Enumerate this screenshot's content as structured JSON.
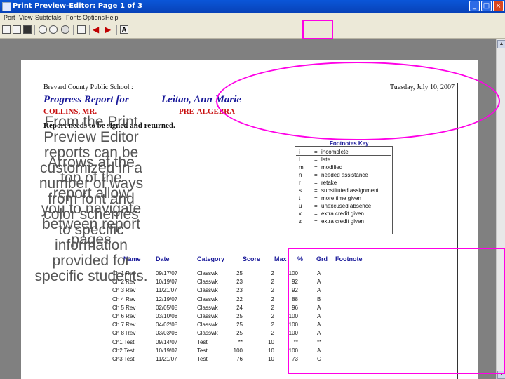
{
  "window": {
    "title": "Print Preview-Editor:  Page 1 of 3",
    "minimize_glyph": "_",
    "maximize_glyph": "□",
    "close_glyph": "×"
  },
  "menu": [
    "Port",
    "View",
    "Subtotals",
    "Fonts",
    "Options",
    "Help"
  ],
  "toolbar": {
    "icons": [
      "print-icon",
      "setup-icon",
      "save-icon",
      "zoom-in-icon",
      "zoom-out-icon",
      "zoom-fit-icon",
      "page-icon",
      "prev-page-icon",
      "next-page-icon",
      "font-icon"
    ],
    "font_label": "A"
  },
  "scrollbar": {
    "up": "▲",
    "down": "▼"
  },
  "report": {
    "district": "Brevard County Public School :",
    "date": "Tuesday, July 10, 2007",
    "heading": "Progress Report for",
    "student": "Leitao, Ann Marie",
    "teacher": "COLLINS, MR.",
    "course": "PRE-ALGEBRA",
    "notice": "Report needs to be signed and returned.",
    "footnote_title": "Footnotes Key",
    "footnote_key": [
      {
        "code": "i",
        "desc": "incomplete"
      },
      {
        "code": "l",
        "desc": "late"
      },
      {
        "code": "m",
        "desc": "modified"
      },
      {
        "code": "n",
        "desc": "needed assistance"
      },
      {
        "code": "r",
        "desc": "retake"
      },
      {
        "code": "s",
        "desc": "substituted assignment"
      },
      {
        "code": "t",
        "desc": "more time given"
      },
      {
        "code": "u",
        "desc": "unexcused absence"
      },
      {
        "code": "x",
        "desc": "extra credit given"
      },
      {
        "code": "z",
        "desc": "extra credit given"
      }
    ],
    "columns": [
      "Name",
      "Date",
      "Category",
      "Score",
      "Max",
      "%",
      "Grd",
      "Footnote"
    ],
    "rows": [
      {
        "name": "Ch 1 Rev",
        "date": "09/17/07",
        "cat": "Classwk",
        "score": "25",
        "max": "2",
        "pct": "100",
        "grd": "A"
      },
      {
        "name": "Ch 2 Rev",
        "date": "10/19/07",
        "cat": "Classwk",
        "score": "23",
        "max": "2",
        "pct": "92",
        "grd": "A"
      },
      {
        "name": "Ch 3 Rev",
        "date": "11/21/07",
        "cat": "Classwk",
        "score": "23",
        "max": "2",
        "pct": "92",
        "grd": "A"
      },
      {
        "name": "Ch 4 Rev",
        "date": "12/19/07",
        "cat": "Classwk",
        "score": "22",
        "max": "2",
        "pct": "88",
        "grd": "B"
      },
      {
        "name": "Ch 5 Rev",
        "date": "02/05/08",
        "cat": "Classwk",
        "score": "24",
        "max": "2",
        "pct": "96",
        "grd": "A"
      },
      {
        "name": "Ch 6 Rev",
        "date": "03/10/08",
        "cat": "Classwk",
        "score": "25",
        "max": "2",
        "pct": "100",
        "grd": "A"
      },
      {
        "name": "Ch 7 Rev",
        "date": "04/02/08",
        "cat": "Classwk",
        "score": "25",
        "max": "2",
        "pct": "100",
        "grd": "A"
      },
      {
        "name": "Ch 8 Rev",
        "date": "03/03/08",
        "cat": "Classwk",
        "score": "25",
        "max": "2",
        "pct": "100",
        "grd": "A"
      },
      {
        "name": "Ch1 Test",
        "date": "09/14/07",
        "cat": "Test",
        "score": "**",
        "max": "10",
        "pct": "**",
        "grd": "**"
      },
      {
        "name": "Ch2 Test",
        "date": "10/19/07",
        "cat": "Test",
        "score": "100",
        "max": "10",
        "pct": "100",
        "grd": "A"
      },
      {
        "name": "Ch3 Test",
        "date": "11/21/07",
        "cat": "Test",
        "score": "76",
        "max": "10",
        "pct": "73",
        "grd": "C"
      }
    ]
  },
  "annotation": {
    "lines_a": [
      "From the Print",
      "Preview Editor",
      "reports can be",
      "customized in a",
      "number of ways",
      "from font and",
      "color schemes",
      "to specific",
      "information",
      "provided for",
      "specific students."
    ],
    "lines_b": [
      "Arrows at the",
      "top of the",
      "report allow",
      "you to navigate",
      "between report",
      "pages"
    ]
  },
  "highlight_color": "#ff00e6"
}
